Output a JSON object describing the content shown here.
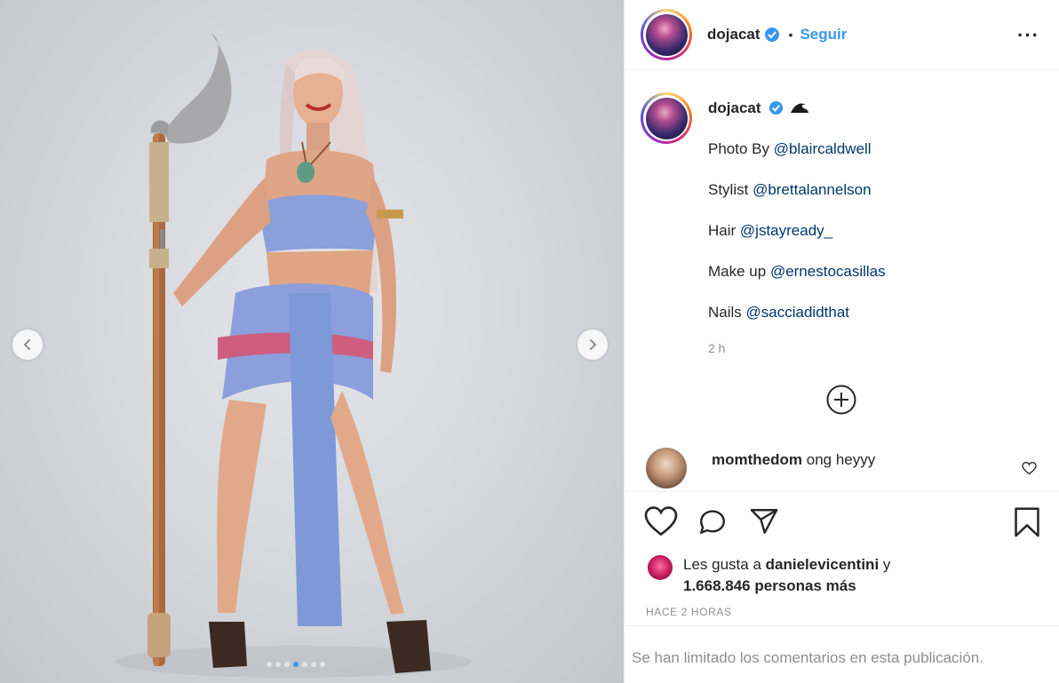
{
  "post": {
    "carousel": {
      "total_slides": 7,
      "active_slide": 4,
      "prev_icon": "chevron-left-icon",
      "next_icon": "chevron-right-icon"
    }
  },
  "header": {
    "username": "dojacat",
    "separator": "•",
    "follow_label": "Seguir",
    "more_label": "···"
  },
  "caption": {
    "username": "dojacat",
    "emoji": "wave-emoji",
    "lines": [
      {
        "prefix": "Photo By ",
        "mention": "@blaircaldwell"
      },
      {
        "prefix": "Stylist ",
        "mention": "@brettalannelson"
      },
      {
        "prefix": "Hair ",
        "mention": "@jstayready_"
      },
      {
        "prefix": "Make up ",
        "mention": "@ernestocasillas"
      },
      {
        "prefix": "Nails ",
        "mention": "@sacciadidthat"
      }
    ],
    "time": "2 h"
  },
  "comment": {
    "username": "momthedom",
    "text": "ong heyyy"
  },
  "likes": {
    "prefix": "Les gusta a ",
    "user": "danielevicentini",
    "joiner": " y",
    "count": "1.668.846 personas más"
  },
  "timestamp": "HACE 2 HORAS",
  "comments_limited": "Se han limitado los comentarios en esta publicación.",
  "colors": {
    "accent": "#3897f0",
    "mention": "#00376b",
    "muted": "#8e8e8e",
    "text": "#262626"
  }
}
